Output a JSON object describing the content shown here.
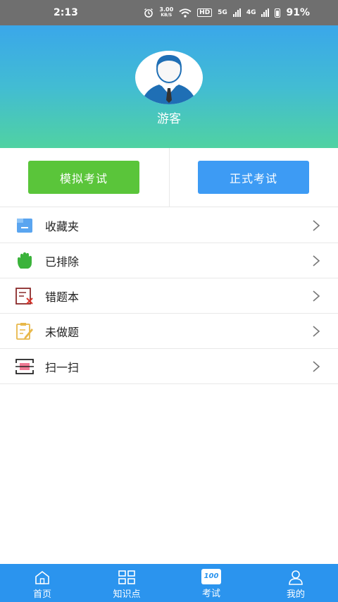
{
  "status_bar": {
    "time": "2:13",
    "net_speed_value": "3.00",
    "net_speed_unit": "KB/S",
    "hd_label": "HD",
    "signal1_label": "5G",
    "signal2_label": "4G",
    "battery": "91%"
  },
  "profile": {
    "username": "游客"
  },
  "exam": {
    "mock_label": "模拟考试",
    "formal_label": "正式考试",
    "mock_color": "#5ac53a",
    "formal_color": "#3d9bf4"
  },
  "menu": {
    "items": [
      {
        "label": "收藏夹",
        "icon": "folder-icon"
      },
      {
        "label": "已排除",
        "icon": "hand-icon"
      },
      {
        "label": "错题本",
        "icon": "wrong-questions-icon"
      },
      {
        "label": "未做题",
        "icon": "edit-note-icon"
      },
      {
        "label": "扫一扫",
        "icon": "scan-icon"
      }
    ]
  },
  "bottom_nav": {
    "items": [
      {
        "label": "首页",
        "icon": "home-icon"
      },
      {
        "label": "知识点",
        "icon": "grid-icon"
      },
      {
        "label": "考试",
        "icon": "exam-100-icon",
        "badge": "100"
      },
      {
        "label": "我的",
        "icon": "user-icon"
      }
    ]
  }
}
